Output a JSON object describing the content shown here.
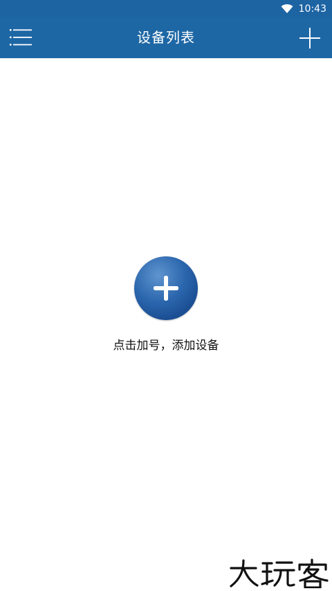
{
  "status_bar": {
    "time": "10:43",
    "icons": [
      "wifi-icon"
    ]
  },
  "app_bar": {
    "title": "设备列表",
    "left_icon": "menu-icon",
    "right_icon": "plus-icon"
  },
  "empty_state": {
    "icon": "plus-icon",
    "hint": "点击加号，添加设备"
  },
  "watermark": {
    "text": "大玩客"
  },
  "colors": {
    "primary": "#1e67a5",
    "status_bar": "#1d64a3",
    "circle": "#2b66ad",
    "background": "#ffffff",
    "text": "#111111"
  }
}
